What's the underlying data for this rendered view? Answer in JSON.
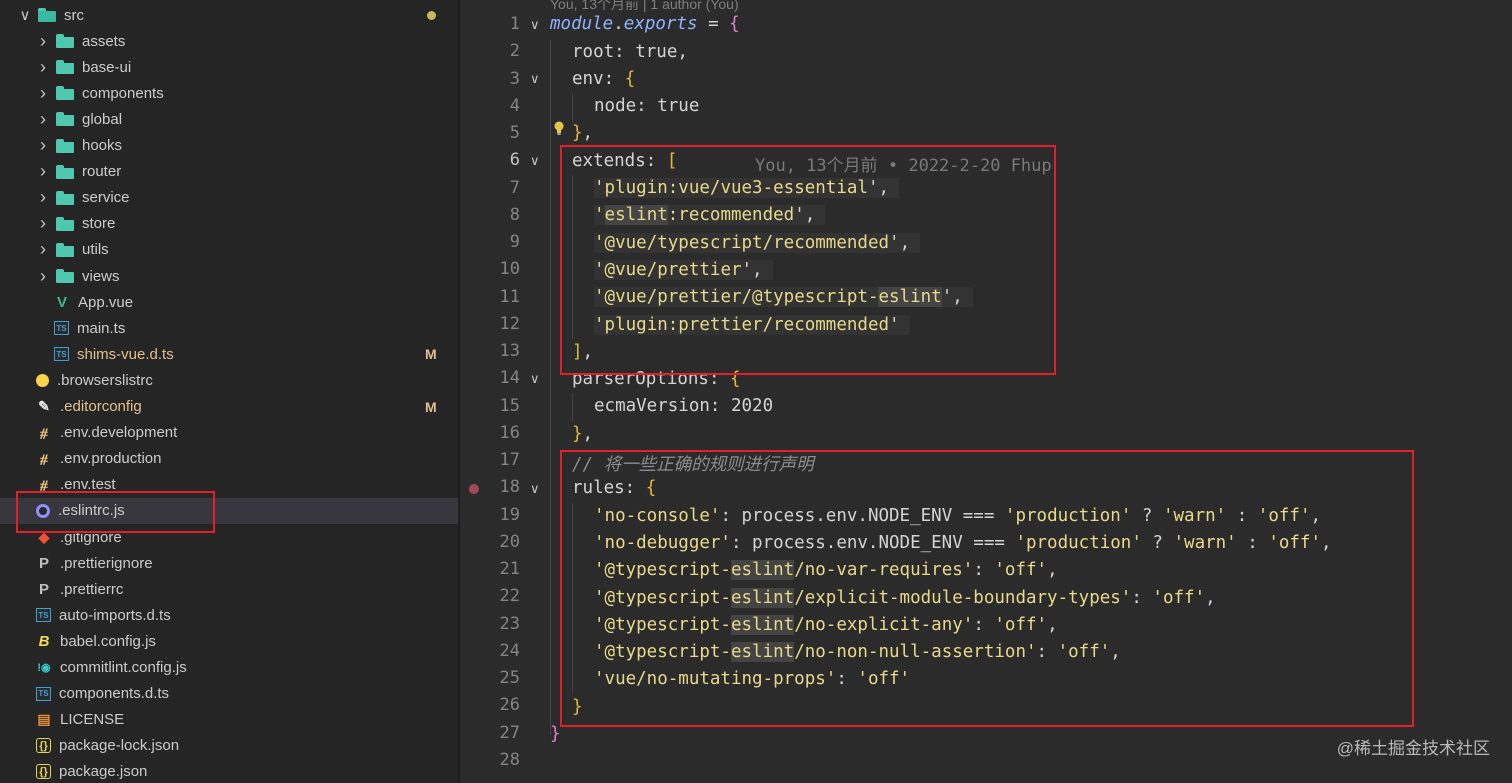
{
  "sidebar": {
    "items": [
      {
        "label": "src",
        "type": "folder-open",
        "modified_dot": true
      },
      {
        "label": "assets",
        "type": "folder"
      },
      {
        "label": "base-ui",
        "type": "folder"
      },
      {
        "label": "components",
        "type": "folder"
      },
      {
        "label": "global",
        "type": "folder"
      },
      {
        "label": "hooks",
        "type": "folder"
      },
      {
        "label": "router",
        "type": "folder"
      },
      {
        "label": "service",
        "type": "folder"
      },
      {
        "label": "store",
        "type": "folder"
      },
      {
        "label": "utils",
        "type": "folder"
      },
      {
        "label": "views",
        "type": "folder"
      },
      {
        "label": "App.vue",
        "type": "vue"
      },
      {
        "label": "main.ts",
        "type": "ts"
      },
      {
        "label": "shims-vue.d.ts",
        "type": "ts",
        "badge": "M"
      },
      {
        "label": ".browserslistrc",
        "type": "browserslist"
      },
      {
        "label": ".editorconfig",
        "type": "editorconfig",
        "badge": "M"
      },
      {
        "label": ".env.development",
        "type": "env"
      },
      {
        "label": ".env.production",
        "type": "env"
      },
      {
        "label": ".env.test",
        "type": "env"
      },
      {
        "label": ".eslintrc.js",
        "type": "eslint",
        "selected": true
      },
      {
        "label": ".gitignore",
        "type": "git"
      },
      {
        "label": ".prettierignore",
        "type": "prettier"
      },
      {
        "label": ".prettierrc",
        "type": "prettier"
      },
      {
        "label": "auto-imports.d.ts",
        "type": "ts"
      },
      {
        "label": "babel.config.js",
        "type": "babel"
      },
      {
        "label": "commitlint.config.js",
        "type": "commitlint"
      },
      {
        "label": "components.d.ts",
        "type": "ts"
      },
      {
        "label": "LICENSE",
        "type": "license"
      },
      {
        "label": "package-lock.json",
        "type": "json"
      },
      {
        "label": "package.json",
        "type": "json"
      }
    ]
  },
  "editor": {
    "codelens": "You, 13个月前 | 1 author (You)",
    "blame": "You, 13个月前 • 2022-2-20 Fhup",
    "lines": [
      {
        "n": "1"
      },
      {
        "n": "2"
      },
      {
        "n": "3"
      },
      {
        "n": "4"
      },
      {
        "n": "5"
      },
      {
        "n": "6"
      },
      {
        "n": "7"
      },
      {
        "n": "8"
      },
      {
        "n": "9"
      },
      {
        "n": "10"
      },
      {
        "n": "11"
      },
      {
        "n": "12"
      },
      {
        "n": "13"
      },
      {
        "n": "14"
      },
      {
        "n": "15"
      },
      {
        "n": "16"
      },
      {
        "n": "17"
      },
      {
        "n": "18"
      },
      {
        "n": "19"
      },
      {
        "n": "20"
      },
      {
        "n": "21"
      },
      {
        "n": "22"
      },
      {
        "n": "23"
      },
      {
        "n": "24"
      },
      {
        "n": "25"
      },
      {
        "n": "26"
      },
      {
        "n": "27"
      },
      {
        "n": "28"
      }
    ],
    "code": {
      "l1a": "module",
      "l1b": ".",
      "l1c": "exports",
      "l1d": " = ",
      "l1e": "{",
      "l2": "root: true,",
      "l3a": "env: ",
      "l3b": "{",
      "l4": "node: true",
      "l5a": "}",
      "l5b": ",",
      "l6a": "extends: ",
      "l6b": "[",
      "l7a": "'",
      "l7b": "plugin:vue/vue3-essential",
      "l7c": "',",
      "l8a": "'",
      "l8b": "eslint",
      "l8c": ":recommended",
      "l8d": "',",
      "l9a": "'",
      "l9b": "@vue/typescript/recommended",
      "l9c": "',",
      "l10a": "'",
      "l10b": "@vue/prettier",
      "l10c": "',",
      "l11a": "'",
      "l11b": "@vue/prettier/@typescript-",
      "l11c": "eslint",
      "l11d": "',",
      "l12a": "'",
      "l12b": "plugin:prettier/recommended",
      "l12c": "'",
      "l13a": "]",
      "l13b": ",",
      "l14a": "parserOptions: ",
      "l14b": "{",
      "l15": "ecmaVersion: 2020",
      "l16a": "}",
      "l16b": ",",
      "l17": "// 将一些正确的规则进行声明",
      "l18a": "rules: ",
      "l18b": "{",
      "l19a": "'no-console'",
      "l19b": ": process.env.NODE_ENV === ",
      "l19c": "'production'",
      "l19d": " ? ",
      "l19e": "'warn'",
      "l19f": " : ",
      "l19g": "'off'",
      "l19h": ",",
      "l20a": "'no-debugger'",
      "l20b": ": process.env.NODE_ENV === ",
      "l20c": "'production'",
      "l20d": " ? ",
      "l20e": "'warn'",
      "l20f": " : ",
      "l20g": "'off'",
      "l20h": ",",
      "l21a": "'@typescript-",
      "l21b": "eslint",
      "l21c": "/no-var-requires'",
      "l21d": ": ",
      "l21e": "'off'",
      "l21f": ",",
      "l22a": "'@typescript-",
      "l22b": "eslint",
      "l22c": "/explicit-module-boundary-types'",
      "l22d": ": ",
      "l22e": "'off'",
      "l22f": ",",
      "l23a": "'@typescript-",
      "l23b": "eslint",
      "l23c": "/no-explicit-any'",
      "l23d": ": ",
      "l23e": "'off'",
      "l23f": ",",
      "l24a": "'@typescript-",
      "l24b": "eslint",
      "l24c": "/no-non-null-assertion'",
      "l24d": ": ",
      "l24e": "'off'",
      "l24f": ",",
      "l25a": "'vue/no-mutating-props'",
      "l25b": ": ",
      "l25c": "'off'",
      "l26": "}",
      "l27": "}"
    }
  },
  "watermark": "@稀土掘金技术社区",
  "colors": {
    "highlight_box": "#e0202a",
    "folder": "#4ec9b0",
    "modified": "#e2c08d"
  }
}
